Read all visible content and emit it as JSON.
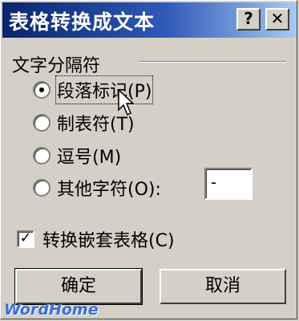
{
  "dialog": {
    "title": "表格转换成文本",
    "help_label": "?",
    "close_label": "✕"
  },
  "separator_group": {
    "label": "文字分隔符",
    "options": [
      {
        "label": "段落标记(P)",
        "checked": true
      },
      {
        "label": "制表符(T)",
        "checked": false
      },
      {
        "label": "逗号(M)",
        "checked": false
      },
      {
        "label": "其他字符(O):",
        "checked": false
      }
    ],
    "other_char_value": "-"
  },
  "convert_nested": {
    "label": "转换嵌套表格(C)",
    "checked": true,
    "check_mark": "✓"
  },
  "buttons": {
    "ok_label": "确定",
    "cancel_label": "取消"
  },
  "watermark": "WordHome"
}
